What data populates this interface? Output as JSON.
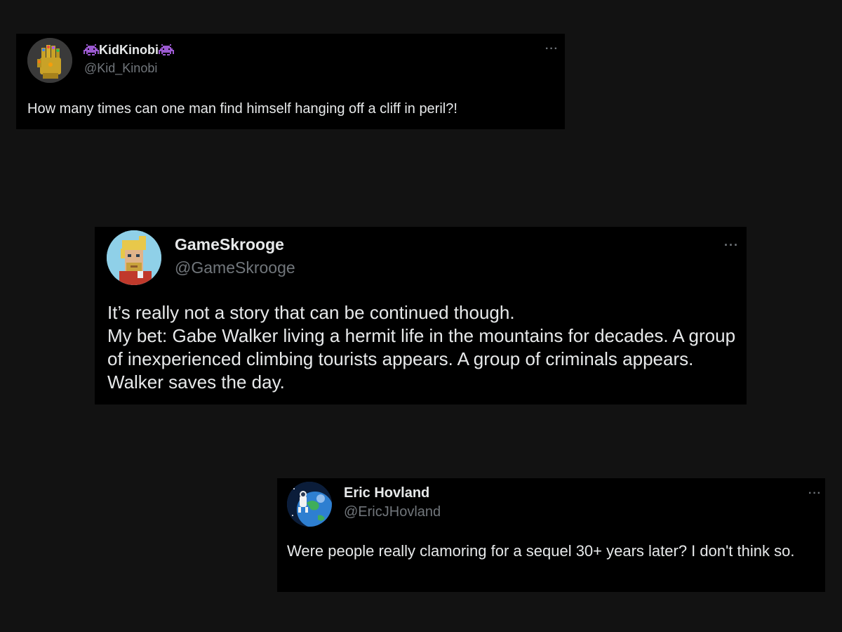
{
  "background_color": "#121212",
  "card_color": "#000000",
  "text_color": "#e7e9ea",
  "muted_color": "#71767b",
  "tweets": [
    {
      "display_name": "KidKinobi",
      "name_decoration_icon": "space-invader-icon",
      "name_decoration_color": "#9b59d0",
      "handle": "@Kid_Kinobi",
      "more_label": "···",
      "avatar_icon": "infinity-gauntlet-avatar",
      "text": "How many times can one man find himself hanging off a cliff in peril?!"
    },
    {
      "display_name": "GameSkrooge",
      "handle": "@GameSkrooge",
      "more_label": "···",
      "avatar_icon": "pixel-character-avatar",
      "text_lines": [
        "It’s really not a story that can be continued though.",
        "My bet: Gabe Walker living a hermit life in the mountains for decades. A group of inexperienced climbing tourists appears. A group of criminals appears. Walker saves the day."
      ]
    },
    {
      "display_name": "Eric Hovland",
      "handle": "@EricJHovland",
      "more_label": "···",
      "avatar_icon": "space-earth-avatar",
      "text": "Were people really clamoring for a sequel 30+ years later?  I don't think so."
    }
  ]
}
